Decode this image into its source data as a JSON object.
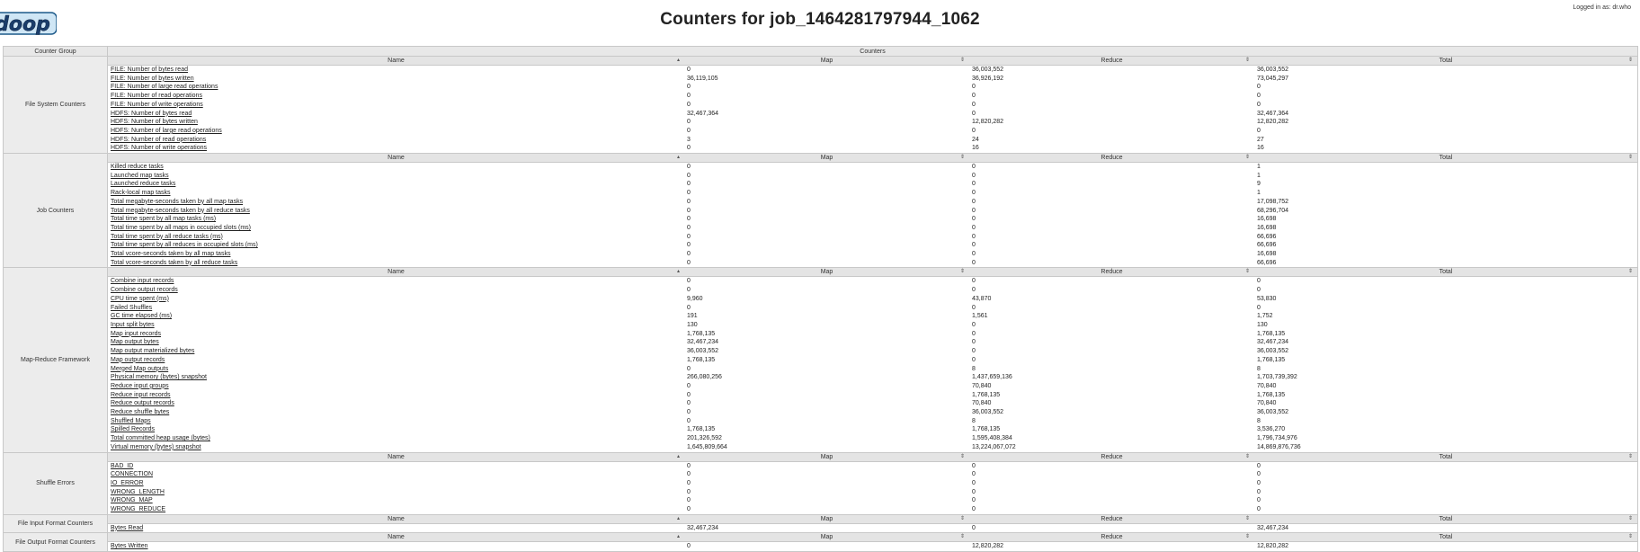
{
  "page": {
    "title": "Counters for job_1464281797944_1062",
    "logged_in": "Logged in as: dr.who",
    "logo_text": "doop"
  },
  "table_header": {
    "group_col": "Counter Group",
    "counters_col": "Counters"
  },
  "subheader": {
    "name": "Name",
    "map": "Map",
    "reduce": "Reduce",
    "total": "Total"
  },
  "groups": [
    {
      "name": "File System Counters",
      "rows": [
        [
          "FILE: Number of bytes read",
          "0",
          "36,003,552",
          "36,003,552"
        ],
        [
          "FILE: Number of bytes written",
          "36,119,105",
          "36,926,192",
          "73,045,297"
        ],
        [
          "FILE: Number of large read operations",
          "0",
          "0",
          "0"
        ],
        [
          "FILE: Number of read operations",
          "0",
          "0",
          "0"
        ],
        [
          "FILE: Number of write operations",
          "0",
          "0",
          "0"
        ],
        [
          "HDFS: Number of bytes read",
          "32,467,364",
          "0",
          "32,467,364"
        ],
        [
          "HDFS: Number of bytes written",
          "0",
          "12,820,282",
          "12,820,282"
        ],
        [
          "HDFS: Number of large read operations",
          "0",
          "0",
          "0"
        ],
        [
          "HDFS: Number of read operations",
          "3",
          "24",
          "27"
        ],
        [
          "HDFS: Number of write operations",
          "0",
          "16",
          "16"
        ]
      ]
    },
    {
      "name": "Job Counters",
      "rows": [
        [
          "Killed reduce tasks",
          "0",
          "0",
          "1"
        ],
        [
          "Launched map tasks",
          "0",
          "0",
          "1"
        ],
        [
          "Launched reduce tasks",
          "0",
          "0",
          "9"
        ],
        [
          "Rack-local map tasks",
          "0",
          "0",
          "1"
        ],
        [
          "Total megabyte-seconds taken by all map tasks",
          "0",
          "0",
          "17,098,752"
        ],
        [
          "Total megabyte-seconds taken by all reduce tasks",
          "0",
          "0",
          "68,296,704"
        ],
        [
          "Total time spent by all map tasks (ms)",
          "0",
          "0",
          "16,698"
        ],
        [
          "Total time spent by all maps in occupied slots (ms)",
          "0",
          "0",
          "16,698"
        ],
        [
          "Total time spent by all reduce tasks (ms)",
          "0",
          "0",
          "66,696"
        ],
        [
          "Total time spent by all reduces in occupied slots (ms)",
          "0",
          "0",
          "66,696"
        ],
        [
          "Total vcore-seconds taken by all map tasks",
          "0",
          "0",
          "16,698"
        ],
        [
          "Total vcore-seconds taken by all reduce tasks",
          "0",
          "0",
          "66,696"
        ]
      ]
    },
    {
      "name": "Map-Reduce Framework",
      "rows": [
        [
          "Combine input records",
          "0",
          "0",
          "0"
        ],
        [
          "Combine output records",
          "0",
          "0",
          "0"
        ],
        [
          "CPU time spent (ms)",
          "9,960",
          "43,870",
          "53,830"
        ],
        [
          "Failed Shuffles",
          "0",
          "0",
          "0"
        ],
        [
          "GC time elapsed (ms)",
          "191",
          "1,561",
          "1,752"
        ],
        [
          "Input split bytes",
          "130",
          "0",
          "130"
        ],
        [
          "Map input records",
          "1,768,135",
          "0",
          "1,768,135"
        ],
        [
          "Map output bytes",
          "32,467,234",
          "0",
          "32,467,234"
        ],
        [
          "Map output materialized bytes",
          "36,003,552",
          "0",
          "36,003,552"
        ],
        [
          "Map output records",
          "1,768,135",
          "0",
          "1,768,135"
        ],
        [
          "Merged Map outputs",
          "0",
          "8",
          "8"
        ],
        [
          "Physical memory (bytes) snapshot",
          "266,080,256",
          "1,437,659,136",
          "1,703,739,392"
        ],
        [
          "Reduce input groups",
          "0",
          "70,840",
          "70,840"
        ],
        [
          "Reduce input records",
          "0",
          "1,768,135",
          "1,768,135"
        ],
        [
          "Reduce output records",
          "0",
          "70,840",
          "70,840"
        ],
        [
          "Reduce shuffle bytes",
          "0",
          "36,003,552",
          "36,003,552"
        ],
        [
          "Shuffled Maps",
          "0",
          "8",
          "8"
        ],
        [
          "Spilled Records",
          "1,768,135",
          "1,768,135",
          "3,536,270"
        ],
        [
          "Total committed heap usage (bytes)",
          "201,326,592",
          "1,595,408,384",
          "1,796,734,976"
        ],
        [
          "Virtual memory (bytes) snapshot",
          "1,645,809,664",
          "13,224,067,072",
          "14,869,876,736"
        ]
      ]
    },
    {
      "name": "Shuffle Errors",
      "rows": [
        [
          "BAD_ID",
          "0",
          "0",
          "0"
        ],
        [
          "CONNECTION",
          "0",
          "0",
          "0"
        ],
        [
          "IO_ERROR",
          "0",
          "0",
          "0"
        ],
        [
          "WRONG_LENGTH",
          "0",
          "0",
          "0"
        ],
        [
          "WRONG_MAP",
          "0",
          "0",
          "0"
        ],
        [
          "WRONG_REDUCE",
          "0",
          "0",
          "0"
        ]
      ]
    },
    {
      "name": "File Input Format Counters",
      "rows": [
        [
          "Bytes Read",
          "32,467,234",
          "0",
          "32,467,234"
        ]
      ]
    },
    {
      "name": "File Output Format Counters",
      "rows": [
        [
          "Bytes Written",
          "0",
          "12,820,282",
          "12,820,282"
        ]
      ]
    }
  ]
}
